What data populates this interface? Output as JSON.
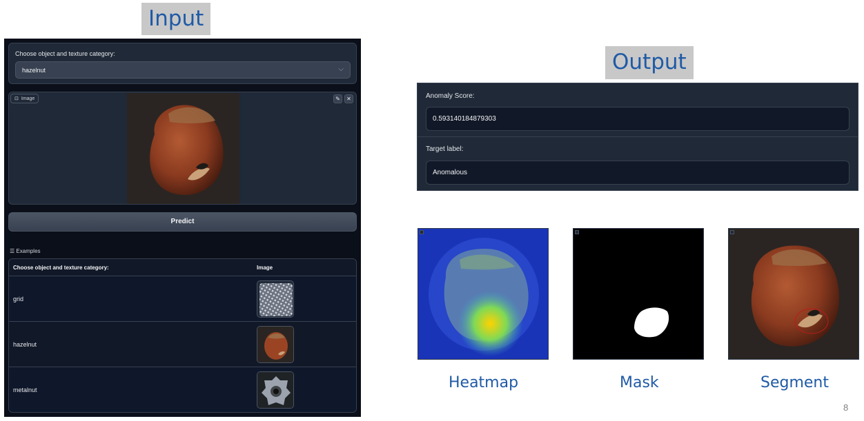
{
  "slide": {
    "input_title": "Input",
    "output_title": "Output",
    "page_number": "8"
  },
  "input_panel": {
    "category_label": "Choose object and texture category:",
    "category_value": "hazelnut",
    "image_label": "Image",
    "image_icon": "image-icon",
    "predict_label": "Predict",
    "examples_label": "Examples",
    "examples": {
      "headers": [
        "Choose object and texture category:",
        "Image"
      ],
      "rows": [
        {
          "category": "grid"
        },
        {
          "category": "hazelnut"
        },
        {
          "category": "metalnut"
        }
      ]
    }
  },
  "output_panel": {
    "anomaly_score_label": "Anomaly Score:",
    "anomaly_score_value": "0.593140184879303",
    "target_label_label": "Target label:",
    "target_label_value": "Anomalous"
  },
  "result_images": {
    "captions": [
      "Heatmap",
      "Mask",
      "Segment"
    ]
  },
  "colors": {
    "title_text": "#1f5aa6",
    "title_bg": "#c8c8c8",
    "panel_dark": "#0b0f19",
    "block": "#1f2937"
  }
}
